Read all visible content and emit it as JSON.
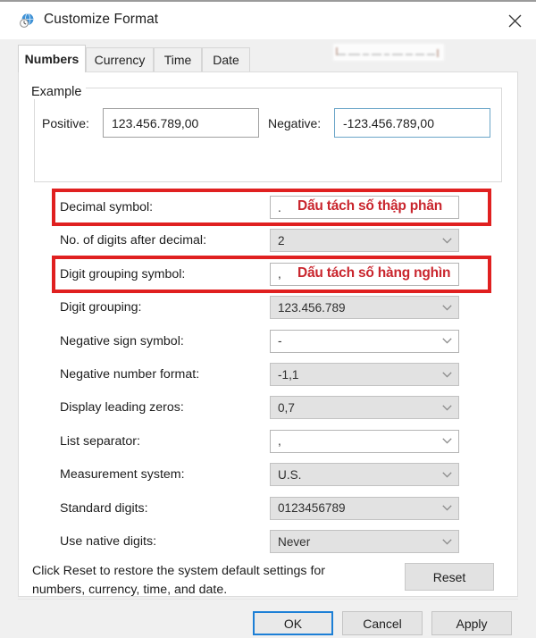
{
  "window": {
    "title": "Customize Format",
    "icon": "region-globe-clock-icon",
    "close_label": "✕"
  },
  "tabs": [
    {
      "label": "Numbers",
      "active": true
    },
    {
      "label": "Currency",
      "active": false
    },
    {
      "label": "Time",
      "active": false
    },
    {
      "label": "Date",
      "active": false
    }
  ],
  "example": {
    "legend": "Example",
    "positive_label": "Positive:",
    "positive_value": "123.456.789,00",
    "negative_label": "Negative:",
    "negative_value": "-123.456.789,00"
  },
  "settings": [
    {
      "label": "Decimal symbol:",
      "value": ".",
      "editable": true,
      "chevron": false,
      "highlighted": true
    },
    {
      "label": "No. of digits after decimal:",
      "value": "2",
      "editable": false,
      "chevron": true,
      "highlighted": false
    },
    {
      "label": "Digit grouping symbol:",
      "value": ",",
      "editable": true,
      "chevron": false,
      "highlighted": true
    },
    {
      "label": "Digit grouping:",
      "value": "123.456.789",
      "editable": false,
      "chevron": true,
      "highlighted": false
    },
    {
      "label": "Negative sign symbol:",
      "value": "-",
      "editable": true,
      "chevron": true,
      "highlighted": false
    },
    {
      "label": "Negative number format:",
      "value": "-1,1",
      "editable": false,
      "chevron": true,
      "highlighted": false
    },
    {
      "label": "Display leading zeros:",
      "value": "0,7",
      "editable": false,
      "chevron": true,
      "highlighted": false
    },
    {
      "label": "List separator:",
      "value": ",",
      "editable": true,
      "chevron": true,
      "highlighted": false
    },
    {
      "label": "Measurement system:",
      "value": "U.S.",
      "editable": false,
      "chevron": true,
      "highlighted": false
    },
    {
      "label": "Standard digits:",
      "value": "0123456789",
      "editable": false,
      "chevron": true,
      "highlighted": false
    },
    {
      "label": "Use native digits:",
      "value": "Never",
      "editable": false,
      "chevron": true,
      "highlighted": false
    }
  ],
  "annotations": [
    {
      "text": "Dấu tách số thập phân",
      "row": 0
    },
    {
      "text": "Dấu tách số hàng nghìn",
      "row": 2
    }
  ],
  "reset": {
    "description": "Click Reset to restore the system default settings for numbers, currency, time, and date.",
    "button_label": "Reset"
  },
  "footer": {
    "ok_label": "OK",
    "cancel_label": "Cancel",
    "apply_label": "Apply"
  },
  "colors": {
    "highlight_red": "#e02020",
    "annotation_red": "#c9252d",
    "focus_blue": "#1c7fd6"
  }
}
